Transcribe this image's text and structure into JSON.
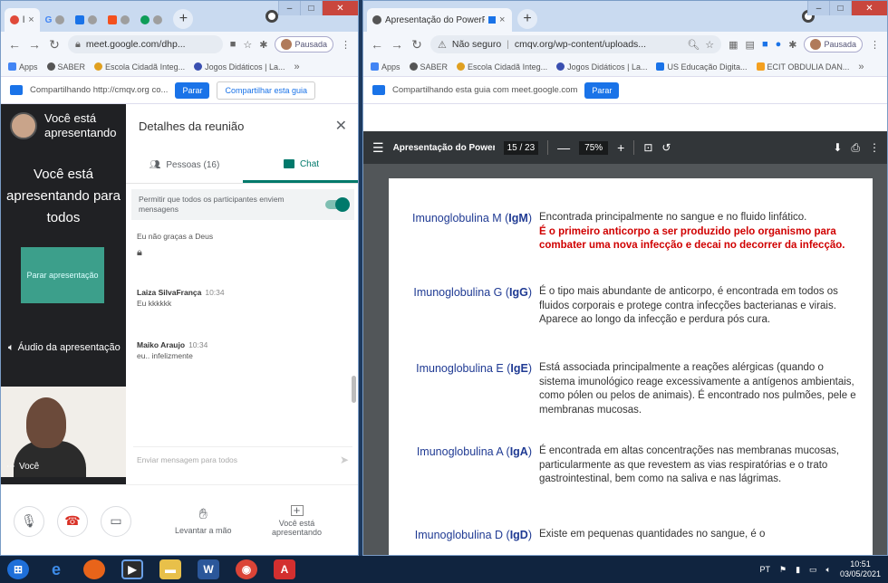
{
  "left_window": {
    "tabs": [
      {
        "label": "l",
        "color": "#e04a3a"
      },
      {
        "label": "G",
        "color": "#4285f4"
      },
      {
        "label": "",
        "color": "#1a73e8"
      },
      {
        "label": "",
        "color": "#f4511e"
      },
      {
        "label": "",
        "color": "#0f9d58"
      }
    ],
    "url": "meet.google.com/dhp...",
    "profile_label": "Pausada",
    "bookmarks": [
      "Apps",
      "SABER",
      "Escola Cidadã Integ...",
      "Jogos Didáticos | La..."
    ],
    "sharebar_text": "Compartilhando http://cmqv.org co...",
    "stop_label": "Parar",
    "share_this_label": "Compartilhar esta guia"
  },
  "meet": {
    "presenting_top": "Você está apresentando",
    "presenting_main": "Você está apresentando para todos",
    "stop_presenting": "Parar apresentação",
    "audio_label": "Áudio da apresentação",
    "self_name": "Você",
    "panel_title": "Detalhes da reunião",
    "people_tab": "Pessoas (16)",
    "chat_tab": "Chat",
    "allow_messages": "Permitir que todos os participantes enviem mensagens",
    "messages": [
      {
        "who": "",
        "time": "",
        "text": "Eu não graças a Deus"
      },
      {
        "who": "Laiza SilvaFrança",
        "time": "10:34",
        "text": "Eu kkkkkk"
      },
      {
        "who": "Maiko Araujo",
        "time": "10:34",
        "text": "eu.. infelizmente"
      }
    ],
    "input_placeholder": "Enviar mensagem para todos",
    "raise_hand": "Levantar a mão",
    "you_presenting": "Você está apresentando"
  },
  "right_window": {
    "tab_title": "Apresentação do PowerPoint",
    "insecure_label": "Não seguro",
    "url": "cmqv.org/wp-content/uploads...",
    "profile_label": "Pausada",
    "bookmarks": [
      "Apps",
      "SABER",
      "Escola Cidadã Integ...",
      "Jogos Didáticos | La...",
      "US Educação Digita...",
      "ECIT OBDULIA DAN..."
    ],
    "sharebar_text": "Compartilhando esta guia com meet.google.com",
    "stop_label": "Parar"
  },
  "pdf": {
    "title": "Apresentação do PowerP...",
    "page_current": "15",
    "page_total": "23",
    "zoom": "75%"
  },
  "immunoglobulins": [
    {
      "name": "Imunoglobulina M",
      "code": "IgM",
      "text": "Encontrada principalmente no sangue e no fluido linfático.",
      "highlight": "É o primeiro anticorpo a ser produzido pelo organismo para combater uma nova infecção e decai no decorrer da infecção."
    },
    {
      "name": "Imunoglobulina G",
      "code": "IgG",
      "text": "É o tipo mais abundante de anticorpo, é encontrada em todos os fluidos corporais e protege contra infecções bacterianas e virais. Aparece ao longo da infecção e perdura pós cura.",
      "highlight": ""
    },
    {
      "name": "Imunoglobulina E",
      "code": "IgE",
      "text": "Está associada principalmente a reações alérgicas (quando o sistema imunológico reage excessivamente a antígenos ambientais, como pólen ou pelos de animais). É encontrado nos pulmões, pele e membranas mucosas.",
      "highlight": ""
    },
    {
      "name": "Imunoglobulina A",
      "code": "IgA",
      "text": "É encontrada em altas concentrações nas membranas mucosas, particularmente as que revestem as vias respiratórias e o trato gastrointestinal, bem como na saliva e nas lágrimas.",
      "highlight": ""
    },
    {
      "name": "Imunoglobulina D",
      "code": "IgD",
      "text": "Existe em pequenas quantidades no sangue, é o",
      "highlight": ""
    }
  ],
  "taskbar": {
    "language": "PT",
    "time": "10:51",
    "date": "03/05/2021"
  },
  "colors": {
    "meet_accent": "#00796b",
    "chrome_blue": "#1a73e8",
    "highlight_red": "#d00000",
    "ig_label_blue": "#1f3a93"
  }
}
